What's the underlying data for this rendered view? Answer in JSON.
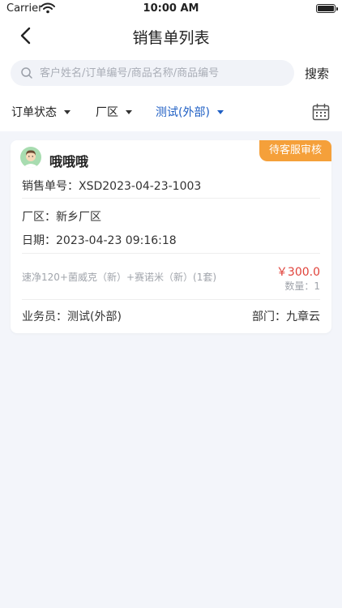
{
  "status_bar": {
    "carrier": "Carrier",
    "time": "10:00 AM"
  },
  "nav": {
    "title": "销售单列表"
  },
  "search": {
    "placeholder": "客户姓名/订单编号/商品名称/商品编号",
    "button_label": "搜索"
  },
  "filters": [
    {
      "label": "订单状态",
      "active": false
    },
    {
      "label": "厂区",
      "active": false
    },
    {
      "label": "测试(外部)",
      "active": true
    }
  ],
  "colors": {
    "accent": "#1f5fc4",
    "badge": "#f5a03a",
    "price": "#e0423a",
    "background": "#f3f5fa"
  },
  "icons": {
    "back": "chevron-left-icon",
    "search": "search-icon",
    "calendar": "calendar-icon",
    "avatar": "user-avatar-icon"
  },
  "orders": [
    {
      "status_badge": "待客服审核",
      "customer_name": "哦哦哦",
      "order_no_line": "销售单号：XSD2023-04-23-1003",
      "factory_line": "厂区：新乡厂区",
      "date_line": "日期：2023-04-23 09:16:18",
      "product_line": "速净120+菌威克（新）+赛诺米（新）(1套)",
      "price": "￥300.0",
      "quantity_line": "数量：1",
      "salesman_line": "业务员：测试(外部)",
      "department_line": "部门：九章云"
    }
  ]
}
